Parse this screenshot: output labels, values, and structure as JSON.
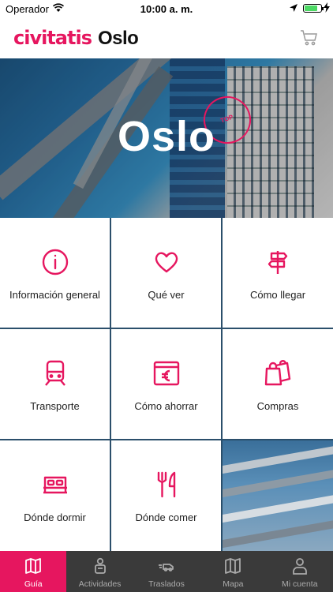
{
  "status_bar": {
    "carrier": "Operador",
    "time": "10:00 a. m."
  },
  "header": {
    "logo": "civitatis",
    "city": "Oslo"
  },
  "hero": {
    "title": "Oslo",
    "stamp": "TOP"
  },
  "menu": [
    {
      "label": "Información general",
      "icon": "info-icon"
    },
    {
      "label": "Qué ver",
      "icon": "heart-icon"
    },
    {
      "label": "Cómo llegar",
      "icon": "signpost-icon"
    },
    {
      "label": "Transporte",
      "icon": "train-icon"
    },
    {
      "label": "Cómo ahorrar",
      "icon": "euro-wallet-icon"
    },
    {
      "label": "Compras",
      "icon": "shopping-bags-icon"
    },
    {
      "label": "Dónde dormir",
      "icon": "bed-icon"
    },
    {
      "label": "Dónde comer",
      "icon": "fork-knife-icon"
    }
  ],
  "tabs": [
    {
      "label": "Guía",
      "icon": "map-book-icon",
      "active": true
    },
    {
      "label": "Actividades",
      "icon": "traveler-icon",
      "active": false
    },
    {
      "label": "Traslados",
      "icon": "car-transfer-icon",
      "active": false
    },
    {
      "label": "Mapa",
      "icon": "map-icon",
      "active": false
    },
    {
      "label": "Mi cuenta",
      "icon": "user-icon",
      "active": false
    }
  ],
  "colors": {
    "accent": "#e6165f",
    "tabbar_bg": "#3a3a3a"
  }
}
